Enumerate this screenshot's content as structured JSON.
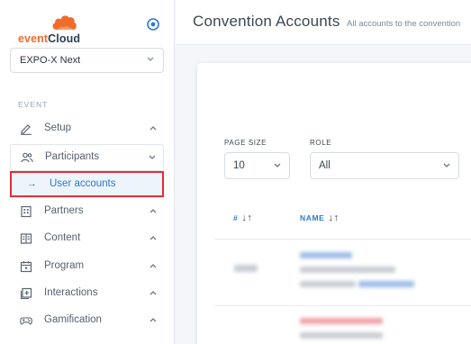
{
  "brand": {
    "name_part1": "event",
    "name_part2": "Cloud",
    "accent_color": "#ef6c2d"
  },
  "sidebar": {
    "event_select": {
      "value": "EXPO-X Next"
    },
    "section_label": "EVENT",
    "items": [
      {
        "label": "Setup",
        "icon": "pencil-icon",
        "expanded": false
      },
      {
        "label": "Participants",
        "icon": "users-icon",
        "expanded": true,
        "children": [
          {
            "label": "User accounts",
            "active": true
          }
        ]
      },
      {
        "label": "Partners",
        "icon": "building-icon",
        "expanded": false
      },
      {
        "label": "Content",
        "icon": "book-icon",
        "expanded": false
      },
      {
        "label": "Program",
        "icon": "calendar-icon",
        "expanded": false
      },
      {
        "label": "Interactions",
        "icon": "plus-square-icon",
        "expanded": false
      },
      {
        "label": "Gamification",
        "icon": "gamepad-icon",
        "expanded": false
      }
    ]
  },
  "header": {
    "title": "Convention Accounts",
    "subtitle": "All accounts to the convention"
  },
  "filters": {
    "page_size": {
      "label": "PAGE SIZE",
      "value": "10"
    },
    "role": {
      "label": "ROLE",
      "value": "All"
    }
  },
  "table": {
    "columns": [
      {
        "label": "#",
        "sortable": true
      },
      {
        "label": "NAME",
        "sortable": true
      }
    ]
  },
  "colors": {
    "link_blue": "#2f78d6",
    "highlight_red": "#e02e36"
  }
}
